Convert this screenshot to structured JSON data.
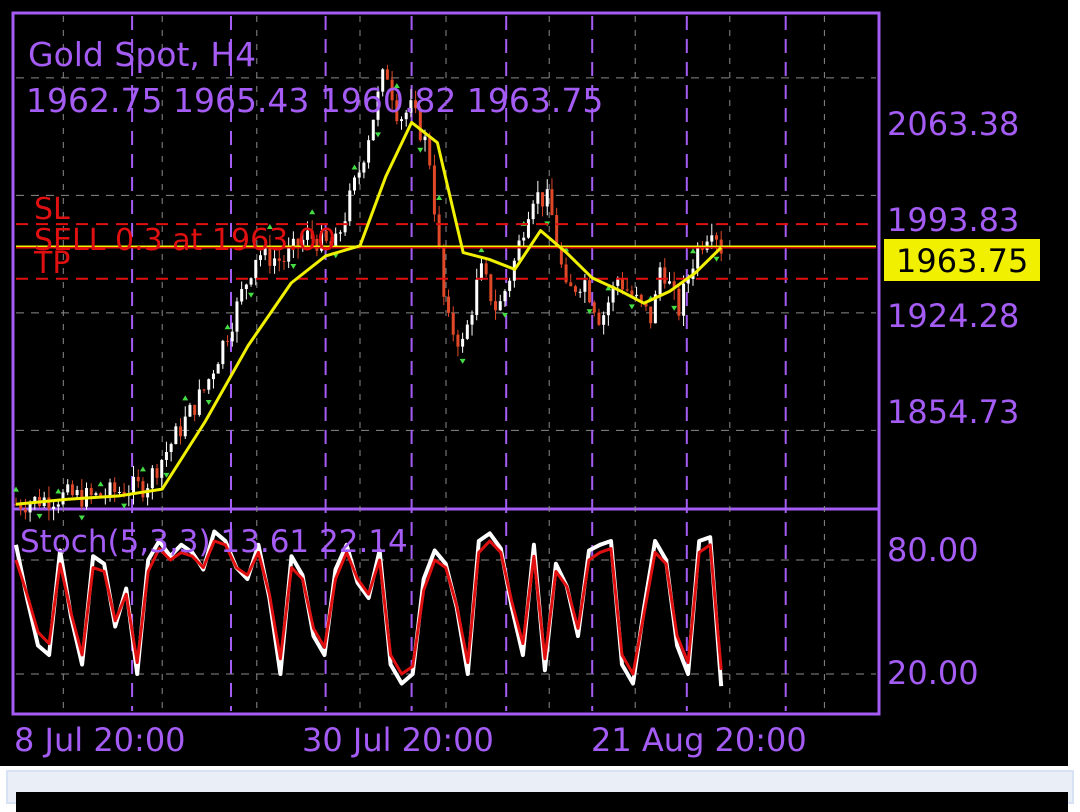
{
  "header": {
    "symbol_line": "Gold Spot, H4",
    "ohlc_line": "1962.75 1965.43 1960.82 1963.75"
  },
  "order_labels": {
    "sl": "SL",
    "sell": "SELL 0.3 at 1963.00",
    "tp": "TP"
  },
  "indicator": {
    "label": "Stoch(5,3,3) 13.61 22.14"
  },
  "colors": {
    "background": "#000000",
    "frame": "#a45cf5",
    "text": "#a45cf5",
    "grid": "#8a8a8a",
    "bull_candle": "#ffffff",
    "bear_candle": "#e04828",
    "ma_line": "#f0f000",
    "price_line": "#f0f000",
    "order_line": "#e01010",
    "fractal_marker": "#44dd44",
    "stoch_main": "#ffffff",
    "stoch_signal": "#e01010",
    "current_price_bg": "#f0f000"
  },
  "chart_data": [
    {
      "type": "candlestick",
      "title": "Gold Spot, H4",
      "ohlc_readout": {
        "open": 1962.75,
        "high": 1965.43,
        "low": 1960.82,
        "close": 1963.75
      },
      "ylim": [
        1810,
        2100
      ],
      "y_ticks": [
        "2063.38",
        "1993.83",
        "1924.28",
        "1854.73"
      ],
      "x_ticks": [
        "8 Jul 20:00",
        "30 Jul 20:00",
        "21 Aug 20:00"
      ],
      "current_price": "1963.75",
      "order_levels": {
        "sl": 1976.8,
        "sell": 1963.0,
        "tp": 1944.5
      },
      "price_path": [
        [
          0,
          1811
        ],
        [
          0.03,
          1814
        ],
        [
          0.06,
          1816
        ],
        [
          0.09,
          1815
        ],
        [
          0.12,
          1819
        ],
        [
          0.15,
          1822
        ],
        [
          0.19,
          1855
        ],
        [
          0.22,
          1880
        ],
        [
          0.25,
          1918
        ],
        [
          0.28,
          1960
        ],
        [
          0.31,
          1955
        ],
        [
          0.34,
          1970
        ],
        [
          0.37,
          1962
        ],
        [
          0.4,
          2010
        ],
        [
          0.43,
          2070
        ],
        [
          0.445,
          2040
        ],
        [
          0.46,
          2045
        ],
        [
          0.48,
          2020
        ],
        [
          0.5,
          1920
        ],
        [
          0.52,
          1905
        ],
        [
          0.54,
          1950
        ],
        [
          0.56,
          1925
        ],
        [
          0.58,
          1955
        ],
        [
          0.6,
          1995
        ],
        [
          0.62,
          1990
        ],
        [
          0.64,
          1935
        ],
        [
          0.66,
          1945
        ],
        [
          0.68,
          1920
        ],
        [
          0.7,
          1945
        ],
        [
          0.72,
          1932
        ],
        [
          0.74,
          1920
        ],
        [
          0.75,
          1955
        ],
        [
          0.77,
          1925
        ],
        [
          0.79,
          1960
        ],
        [
          0.81,
          1978
        ],
        [
          0.82,
          1963
        ]
      ],
      "ma_path": [
        [
          0,
          1811
        ],
        [
          0.06,
          1814
        ],
        [
          0.12,
          1816
        ],
        [
          0.17,
          1820
        ],
        [
          0.22,
          1860
        ],
        [
          0.27,
          1905
        ],
        [
          0.32,
          1942
        ],
        [
          0.36,
          1958
        ],
        [
          0.4,
          1964
        ],
        [
          0.43,
          2005
        ],
        [
          0.46,
          2037
        ],
        [
          0.49,
          2025
        ],
        [
          0.52,
          1960
        ],
        [
          0.55,
          1956
        ],
        [
          0.58,
          1950
        ],
        [
          0.61,
          1973
        ],
        [
          0.64,
          1960
        ],
        [
          0.67,
          1945
        ],
        [
          0.7,
          1938
        ],
        [
          0.73,
          1930
        ],
        [
          0.76,
          1937
        ],
        [
          0.79,
          1948
        ],
        [
          0.82,
          1963
        ]
      ]
    },
    {
      "type": "line",
      "title": "Stoch(5,3,3) 13.61 22.14",
      "ylim": [
        0,
        100
      ],
      "y_ticks": [
        "80.00",
        "20.00"
      ],
      "series": [
        {
          "name": "Stoch main",
          "last": 13.61,
          "values": [
            88,
            60,
            35,
            30,
            85,
            50,
            25,
            82,
            78,
            45,
            65,
            20,
            80,
            90,
            82,
            88,
            84,
            75,
            95,
            90,
            76,
            70,
            88,
            60,
            20,
            82,
            72,
            40,
            30,
            75,
            88,
            68,
            60,
            85,
            25,
            15,
            20,
            70,
            85,
            78,
            55,
            20,
            90,
            94,
            86,
            55,
            30,
            88,
            22,
            78,
            66,
            40,
            85,
            88,
            90,
            25,
            15,
            55,
            90,
            80,
            35,
            20,
            90,
            92,
            13.61
          ]
        },
        {
          "name": "Stoch signal",
          "last": 22.14,
          "values": [
            80,
            62,
            42,
            36,
            78,
            52,
            30,
            76,
            74,
            48,
            62,
            26,
            74,
            86,
            80,
            84,
            82,
            76,
            90,
            88,
            76,
            72,
            84,
            62,
            28,
            76,
            70,
            44,
            34,
            70,
            84,
            70,
            62,
            80,
            30,
            20,
            24,
            64,
            80,
            76,
            56,
            26,
            84,
            90,
            84,
            58,
            36,
            82,
            28,
            74,
            66,
            44,
            80,
            84,
            86,
            30,
            20,
            52,
            84,
            78,
            40,
            26,
            84,
            88,
            22.14
          ]
        }
      ]
    }
  ]
}
